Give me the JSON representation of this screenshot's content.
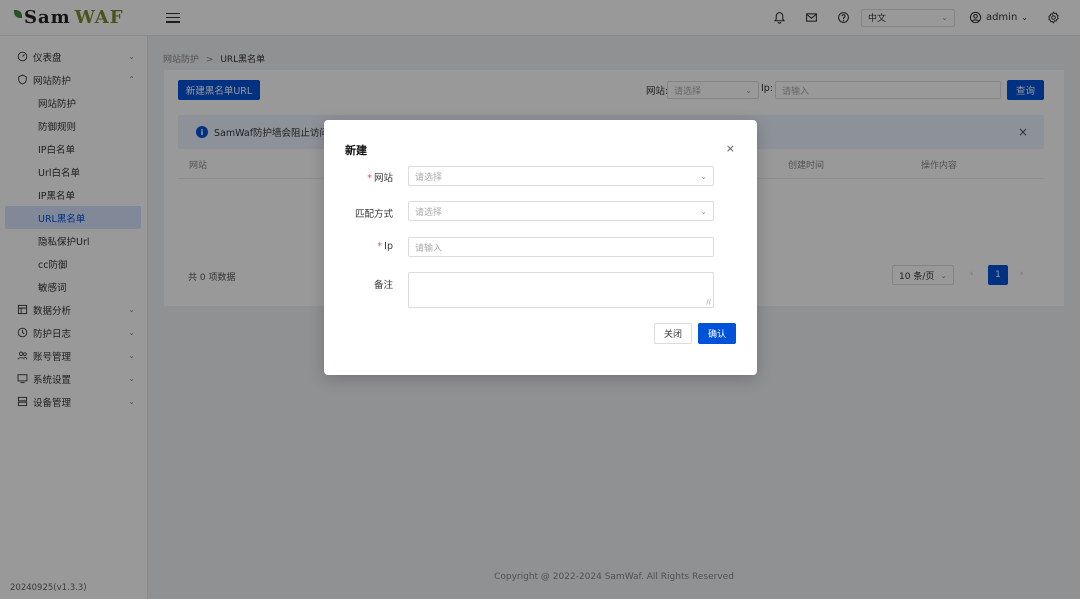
{
  "brand": {
    "name_part1": "Sam",
    "name_part2": "WAF"
  },
  "header": {
    "language": "中文",
    "user": "admin",
    "icons": [
      "bell-icon",
      "mail-icon",
      "help-icon",
      "user-circle-icon",
      "settings-icon"
    ]
  },
  "sidebar": {
    "groups": [
      {
        "label": "仪表盘",
        "icon": "dashboard-icon"
      },
      {
        "label": "网站防护",
        "icon": "shield-icon",
        "expanded": true,
        "items": [
          "网站防护",
          "防御规则",
          "IP白名单",
          "Url白名单",
          "IP黑名单",
          "URL黑名单",
          "隐私保护Url",
          "cc防御",
          "敏感词"
        ],
        "active": "URL黑名单"
      },
      {
        "label": "数据分析",
        "icon": "chart-icon"
      },
      {
        "label": "防护日志",
        "icon": "log-icon"
      },
      {
        "label": "账号管理",
        "icon": "user-group-icon"
      },
      {
        "label": "系统设置",
        "icon": "system-icon"
      },
      {
        "label": "设备管理",
        "icon": "server-icon"
      }
    ],
    "version": "20240925(v1.3.3)"
  },
  "breadcrumb": {
    "parent": "网站防护",
    "separator": ">",
    "current": "URL黑名单"
  },
  "toolbar": {
    "new_button": "新建黑名单URL",
    "site_label": "网站:",
    "site_placeholder": "请选择",
    "ip_label": "Ip:",
    "ip_placeholder": "请输入",
    "query_button": "查询"
  },
  "alert": {
    "text": "SamWaf防护墙会阻止访问存"
  },
  "table": {
    "columns": [
      "网站",
      "创建时间",
      "操作内容"
    ],
    "total_text": "共 0 项数据",
    "page_size": "10 条/页",
    "current_page": "1"
  },
  "footer": {
    "copyright": "Copyright @ 2022-2024 SamWaf. All Rights Reserved"
  },
  "dialog": {
    "title": "新建",
    "fields": {
      "site": {
        "label": "网站",
        "required": true,
        "placeholder": "请选择"
      },
      "match": {
        "label": "匹配方式",
        "required": false,
        "placeholder": "请选择"
      },
      "ip": {
        "label": "Ip",
        "required": true,
        "placeholder": "请输入"
      },
      "remark": {
        "label": "备注",
        "required": false,
        "placeholder": ""
      }
    },
    "cancel_button": "关闭",
    "confirm_button": "确认"
  }
}
